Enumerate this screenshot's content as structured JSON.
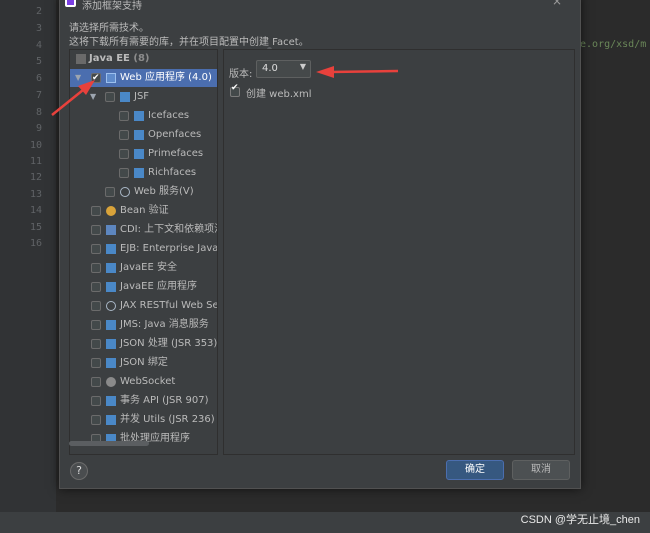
{
  "editor": {
    "line_numbers": [
      "2",
      "3",
      "4",
      "5",
      "6",
      "7",
      "8",
      "9",
      "10",
      "11",
      "12",
      "13",
      "14",
      "15",
      "16"
    ],
    "code_fragment": "ne.org/xsd/m"
  },
  "dialog": {
    "title": "添加框架支持",
    "description_line1": "请选择所需技术。",
    "description_line2": "这将下载所有需要的库，并在项目配置中创建 Facet。",
    "tree": [
      {
        "label": "Java EE",
        "count": "(8)"
      },
      {
        "label": "Web 应用程序 (4.0)"
      },
      {
        "label": "JSF"
      },
      {
        "label": "Icefaces"
      },
      {
        "label": "Openfaces"
      },
      {
        "label": "Primefaces"
      },
      {
        "label": "Richfaces"
      },
      {
        "label": "Web 服务(V)"
      },
      {
        "label": "Bean 验证"
      },
      {
        "label": "CDI: 上下文和依赖项注"
      },
      {
        "label": "EJB: Enterprise Java Be"
      },
      {
        "label": "JavaEE 安全"
      },
      {
        "label": "JavaEE 应用程序"
      },
      {
        "label": "JAX RESTful Web Serv"
      },
      {
        "label": "JMS: Java 消息服务"
      },
      {
        "label": "JSON 处理 (JSR 353)"
      },
      {
        "label": "JSON 绑定"
      },
      {
        "label": "WebSocket"
      },
      {
        "label": "事务 API (JSR 907)"
      },
      {
        "label": "并发 Utils (JSR 236)"
      },
      {
        "label": "批处理应用程序"
      }
    ],
    "version_label": "版本:",
    "version_value": "4.0",
    "create_xml_label": "创建 web.xml",
    "help_label": "?",
    "ok_label": "确定",
    "cancel_label": "取消"
  },
  "watermark": "CSDN @学无止境_chen",
  "colors": {
    "selection": "#4b6eaf",
    "ok_button": "#365880",
    "annotation_arrow": "#e8413c"
  },
  "icons": [
    "app-icon",
    "web-app-icon",
    "jsf-icon",
    "globe-icon",
    "bean-icon",
    "websocket-icon",
    "chevron-down-icon",
    "help-icon",
    "close-icon"
  ]
}
